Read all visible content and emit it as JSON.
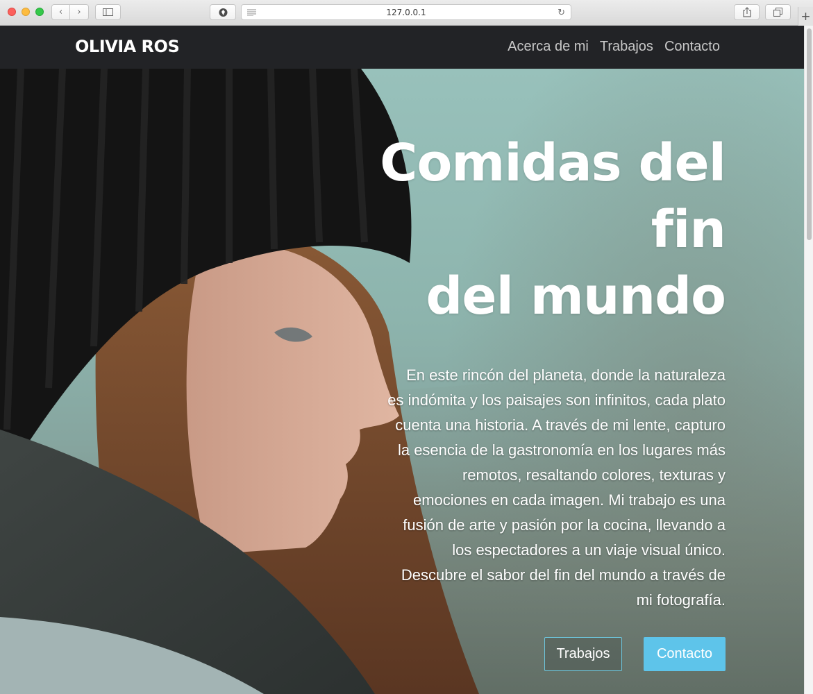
{
  "browser": {
    "url": "127.0.0.1"
  },
  "site": {
    "brand": "OLIVIA ROS",
    "nav": [
      {
        "label": "Acerca de mi"
      },
      {
        "label": "Trabajos"
      },
      {
        "label": "Contacto"
      }
    ]
  },
  "hero": {
    "title_lines": [
      "Comidas del",
      "fin",
      "del mundo"
    ],
    "text_lines": [
      "En este rincón del planeta, donde la naturaleza",
      "es indómita y los paisajes son infinitos, cada plato",
      "cuenta una historia. A través de mi lente, capturo",
      "la esencia de la gastronomía en los lugares más",
      "remotos, resaltando colores, texturas y",
      "emociones en cada imagen. Mi trabajo es una",
      "fusión de arte y pasión por la cocina, llevando a",
      "los espectadores a un viaje visual único.",
      "Descubre el sabor del fin del mundo a través de",
      "mi fotografía."
    ],
    "buttons": {
      "works": "Trabajos",
      "contact": "Contacto"
    }
  },
  "colors": {
    "navbar": "#222326",
    "primary_button": "#5ec4ea",
    "outline_border": "#6ec6dd"
  }
}
